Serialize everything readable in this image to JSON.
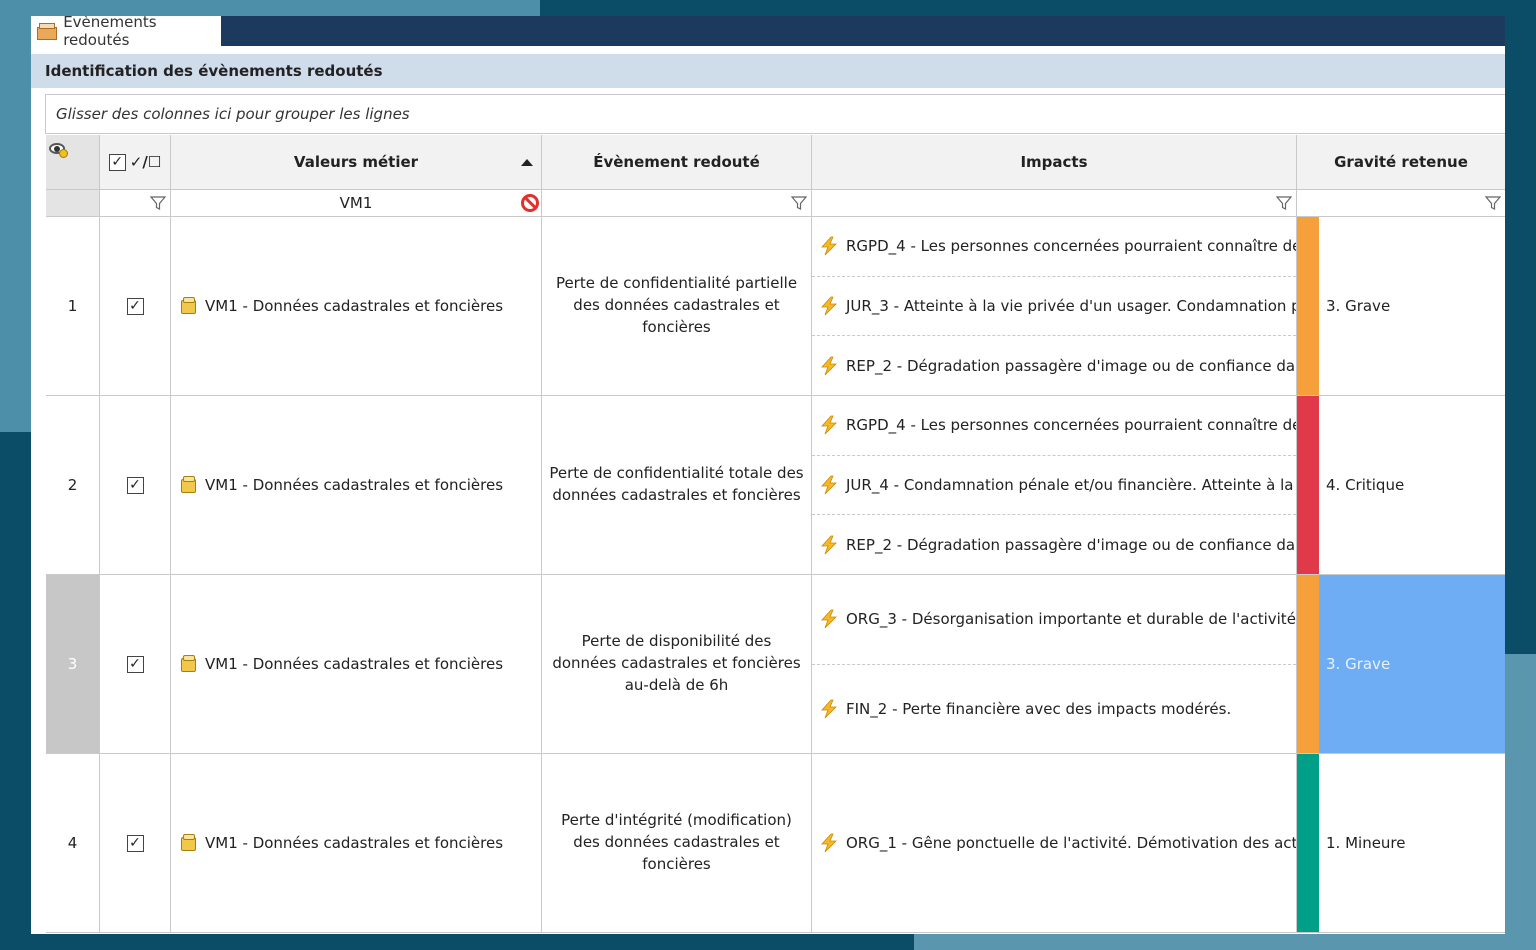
{
  "window": {
    "tab_title": "Èvènements redoutés"
  },
  "panel": {
    "title": "Identification des évènements redoutés"
  },
  "grouping": {
    "hint": "Glisser des colonnes ici pour grouper les lignes"
  },
  "columns": {
    "check_all": "✓/☐",
    "valeurs_metier": "Valeurs métier",
    "evenement": "Évènement redouté",
    "impacts": "Impacts",
    "gravite": "Gravité retenue"
  },
  "filters": {
    "valeurs_metier": "VM1"
  },
  "colors": {
    "grave": "#f6a03c",
    "critique": "#e03a4a",
    "mineure": "#00a088",
    "selected": "#6eadf4",
    "header_band": "#cfdcea",
    "title_bar": "#1c3a5e"
  },
  "rows": [
    {
      "num": "1",
      "checked": true,
      "valeur_metier": "VM1 - Données cadastrales et foncières",
      "evenement": "Perte de confidentialité partielle des données cadastrales et foncières",
      "impacts": [
        "RGPD_4 - Les personnes concernées pourraient connaître de...",
        "JUR_3 - Atteinte à la vie privée d'un usager. Condamnation p...",
        "REP_2 - Dégradation passagère d'image ou de confiance da..."
      ],
      "gravite": "3. Grave",
      "gravite_color": "#f6a03c"
    },
    {
      "num": "2",
      "checked": true,
      "valeur_metier": "VM1 - Données cadastrales et foncières",
      "evenement": "Perte de confidentialité totale des données cadastrales et foncières",
      "impacts": [
        "RGPD_4 - Les personnes concernées pourraient connaître de...",
        "JUR_4 - Condamnation pénale et/ou financière. Atteinte à la ...",
        "REP_2 - Dégradation passagère d'image ou de confiance da..."
      ],
      "gravite": "4. Critique",
      "gravite_color": "#e03a4a"
    },
    {
      "num": "3",
      "checked": true,
      "selected": true,
      "valeur_metier": "VM1 - Données cadastrales et foncières",
      "evenement": "Perte de disponibilité des données cadastrales et foncières au-delà de 6h",
      "impacts": [
        "ORG_3 - Désorganisation importante et durable de l'activité ...",
        "FIN_2 - Perte financière avec des impacts modérés."
      ],
      "gravite": "3. Grave",
      "gravite_color": "#f6a03c"
    },
    {
      "num": "4",
      "checked": true,
      "valeur_metier": "VM1 - Données cadastrales et foncières",
      "evenement": "Perte d'intégrité (modification) des données cadastrales et foncières",
      "impacts": [
        "ORG_1 - Gêne ponctuelle de l'activité. Démotivation des act..."
      ],
      "gravite": "1. Mineure",
      "gravite_color": "#00a088"
    }
  ]
}
